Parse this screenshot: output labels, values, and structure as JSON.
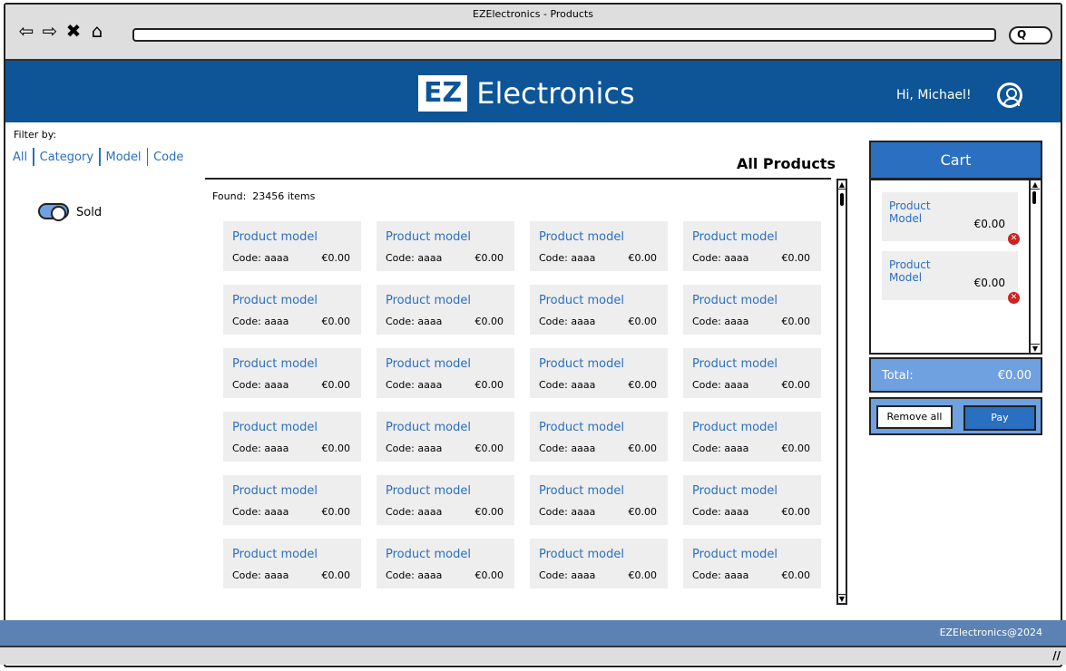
{
  "window": {
    "title": "EZElectronics - Products"
  },
  "browser": {
    "back_icon": "arrow-left-icon",
    "forward_icon": "arrow-right-icon",
    "close_icon": "close-icon",
    "home_icon": "home-icon",
    "search_icon": "search-icon"
  },
  "header": {
    "logo_badge": "EZ",
    "logo_text": "Electronics",
    "greeting": "Hi, Michael!",
    "user_icon": "user-circle-icon",
    "bg_color": "#0d5597"
  },
  "filters": {
    "label": "Filter by:",
    "links": [
      "All",
      "Category",
      "Model",
      "Code"
    ],
    "toggle_label": "Sold",
    "toggle_on": true
  },
  "products": {
    "title": "All Products",
    "found_label": "Found:",
    "found_count": "23456 items",
    "items": [
      {
        "model": "Product model",
        "code": "Code: aaaa",
        "price": "€0.00"
      },
      {
        "model": "Product model",
        "code": "Code: aaaa",
        "price": "€0.00"
      },
      {
        "model": "Product model",
        "code": "Code: aaaa",
        "price": "€0.00"
      },
      {
        "model": "Product model",
        "code": "Code: aaaa",
        "price": "€0.00"
      },
      {
        "model": "Product model",
        "code": "Code: aaaa",
        "price": "€0.00"
      },
      {
        "model": "Product model",
        "code": "Code: aaaa",
        "price": "€0.00"
      },
      {
        "model": "Product model",
        "code": "Code: aaaa",
        "price": "€0.00"
      },
      {
        "model": "Product model",
        "code": "Code: aaaa",
        "price": "€0.00"
      },
      {
        "model": "Product model",
        "code": "Code: aaaa",
        "price": "€0.00"
      },
      {
        "model": "Product model",
        "code": "Code: aaaa",
        "price": "€0.00"
      },
      {
        "model": "Product model",
        "code": "Code: aaaa",
        "price": "€0.00"
      },
      {
        "model": "Product model",
        "code": "Code: aaaa",
        "price": "€0.00"
      },
      {
        "model": "Product model",
        "code": "Code: aaaa",
        "price": "€0.00"
      },
      {
        "model": "Product model",
        "code": "Code: aaaa",
        "price": "€0.00"
      },
      {
        "model": "Product model",
        "code": "Code: aaaa",
        "price": "€0.00"
      },
      {
        "model": "Product model",
        "code": "Code: aaaa",
        "price": "€0.00"
      },
      {
        "model": "Product model",
        "code": "Code: aaaa",
        "price": "€0.00"
      },
      {
        "model": "Product model",
        "code": "Code: aaaa",
        "price": "€0.00"
      },
      {
        "model": "Product model",
        "code": "Code: aaaa",
        "price": "€0.00"
      },
      {
        "model": "Product model",
        "code": "Code: aaaa",
        "price": "€0.00"
      },
      {
        "model": "Product model",
        "code": "Code: aaaa",
        "price": "€0.00"
      },
      {
        "model": "Product model",
        "code": "Code: aaaa",
        "price": "€0.00"
      },
      {
        "model": "Product model",
        "code": "Code: aaaa",
        "price": "€0.00"
      },
      {
        "model": "Product model",
        "code": "Code: aaaa",
        "price": "€0.00"
      }
    ]
  },
  "cart": {
    "title": "Cart",
    "items": [
      {
        "name": "Product Model",
        "price": "€0.00"
      },
      {
        "name": "Product Model",
        "price": "€0.00"
      }
    ],
    "remove_icon": "remove-x-icon",
    "total_label": "Total:",
    "total_value": "€0.00",
    "remove_all_label": "Remove all",
    "pay_label": "Pay",
    "accent_color": "#2a6fc0"
  },
  "footer": {
    "text": "EZElectronics@2024"
  }
}
